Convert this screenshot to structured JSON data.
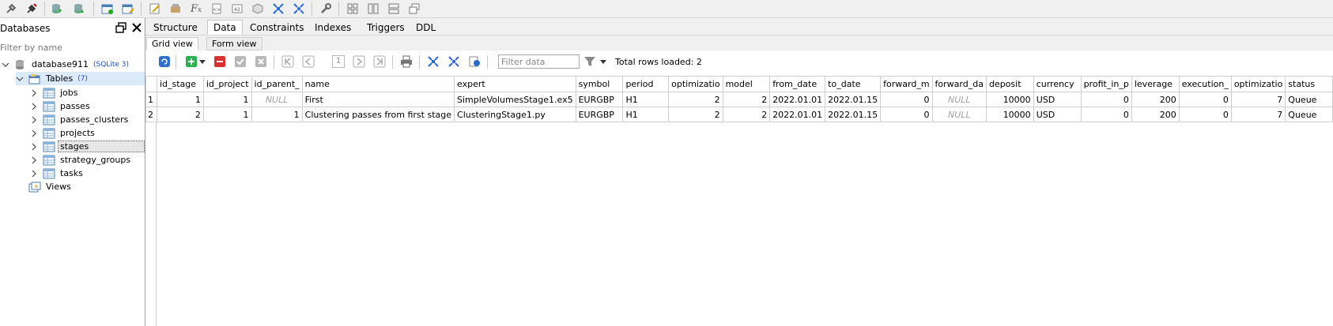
{
  "toolbar": {
    "icons": [
      "disconnect-icon",
      "plug-icon",
      "db-export-icon",
      "db-import-icon",
      "new-table-icon",
      "table-edit-icon",
      "edit-icon",
      "settings-icon",
      "function-icon",
      "view-icon",
      "db-icon",
      "cube-icon",
      "network-icon",
      "network-alt-icon",
      "wrench-icon",
      "layout-grid-icon",
      "layout-cols-icon",
      "layout-rows-icon",
      "layout-cascade-icon"
    ]
  },
  "left_panel": {
    "title": "Databases",
    "filter_placeholder": "Filter by name",
    "database": {
      "name": "database911",
      "suffix": "(SQLite 3)"
    },
    "tables_node": {
      "label": "Tables",
      "count": "(7)"
    },
    "tables": [
      "jobs",
      "passes",
      "passes_clusters",
      "projects",
      "stages",
      "strategy_groups",
      "tasks"
    ],
    "views_label": "Views"
  },
  "object_tabs": [
    "Structure",
    "Data",
    "Constraints",
    "Indexes",
    "Triggers",
    "DDL"
  ],
  "view_tabs": [
    "Grid view",
    "Form view"
  ],
  "data_toolbar": {
    "page_number": "1",
    "filter_placeholder": "Filter data",
    "rows_loaded": "Total rows loaded: 2"
  },
  "grid": {
    "columns": [
      "id_stage",
      "id_project",
      "id_parent_",
      "name",
      "expert",
      "symbol",
      "period",
      "optimizatio",
      "model",
      "from_date",
      "to_date",
      "forward_m",
      "forward_da",
      "deposit",
      "currency",
      "profit_in_p",
      "leverage",
      "execution_",
      "optimizatio",
      "status"
    ],
    "rows": [
      [
        "1",
        "1",
        "NULL",
        "First",
        "SimpleVolumesStage1.ex5",
        "EURGBP",
        "H1",
        "2",
        "2",
        "2022.01.01",
        "2022.01.15",
        "0",
        "NULL",
        "10000",
        "USD",
        "0",
        "200",
        "0",
        "7",
        "Queue"
      ],
      [
        "2",
        "1",
        "1",
        "Clustering passes from first stage",
        "ClusteringStage1.py",
        "EURGBP",
        "H1",
        "2",
        "2",
        "2022.01.01",
        "2022.01.15",
        "0",
        "NULL",
        "10000",
        "USD",
        "0",
        "200",
        "0",
        "7",
        "Queue"
      ]
    ],
    "row_numbers": [
      "1",
      "2"
    ]
  }
}
